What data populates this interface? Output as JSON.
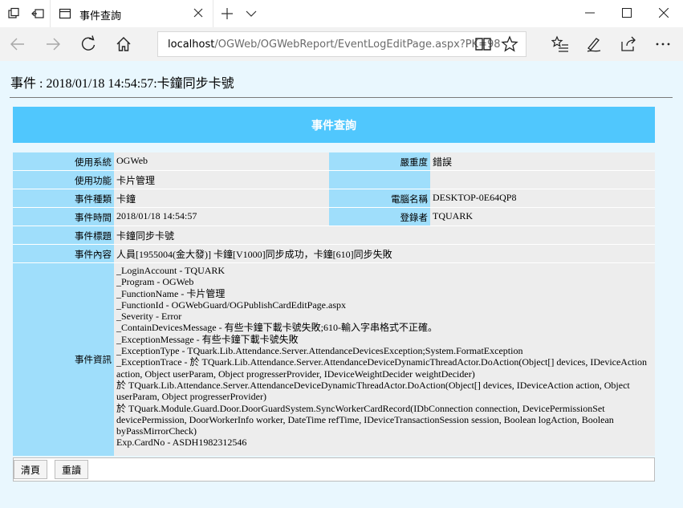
{
  "browser": {
    "tab_title": "事件查詢",
    "address_host": "localhost",
    "address_path": "/OGWeb/OGWebReport/EventLogEditPage.aspx?PK=98"
  },
  "page": {
    "title": "事件 : 2018/01/18 14:54:57:卡鐘同步卡號",
    "panel_title": "事件查詢"
  },
  "fields": {
    "system_label": "使用系統",
    "system_value": "OGWeb",
    "severity_label": "嚴重度",
    "severity_value": "錯誤",
    "function_label": "使用功能",
    "function_value": "卡片管理",
    "type_label": "事件種類",
    "type_value": "卡鐘",
    "computer_label": "電腦名稱",
    "computer_value": "DESKTOP-0E64QP8",
    "time_label": "事件時間",
    "time_value": "2018/01/18 14:54:57",
    "login_label": "登錄者",
    "login_value": "TQUARK",
    "subject_label": "事件標題",
    "subject_value": "卡鐘同步卡號",
    "content_label": "事件內容",
    "content_value": "人員[1955004(金大發)] 卡鐘[V1000]同步成功，卡鐘[610]同步失敗",
    "detail_label": "事件資訊"
  },
  "detail_lines": [
    "_LoginAccount - TQUARK",
    "_Program - OGWeb",
    "_FunctionName - 卡片管理",
    "_FunctionId - OGWebGuard/OGPublishCardEditPage.aspx",
    "_Severity - Error",
    "_ContainDevicesMessage - 有些卡鐘下載卡號失敗;610-輸入字串格式不正確。",
    "_ExceptionMessage - 有些卡鐘下載卡號失敗",
    "_ExceptionType - TQuark.Lib.Attendance.Server.AttendanceDevicesException;System.FormatException",
    "_ExceptionTrace - 於 TQuark.Lib.Attendance.Server.AttendanceDeviceDynamicThreadActor.DoAction(Object[] devices, IDeviceAction action, Object userParam, Object progresserProvider, IDeviceWeightDecider weightDecider)",
    "於 TQuark.Lib.Attendance.Server.AttendanceDeviceDynamicThreadActor.DoAction(Object[] devices, IDeviceAction action, Object userParam, Object progresserProvider)",
    "於 TQuark.Module.Guard.Door.DoorGuardSystem.SyncWorkerCardRecord(IDbConnection connection, DevicePermissionSet devicePermission, DoorWorkerInfo worker, DateTime refTime, IDeviceTransactionSession session, Boolean logAction, Boolean byPassMirrorCheck)",
    "Exp.CardNo - ASDH1982312546"
  ],
  "buttons": {
    "clear_label": "清頁",
    "reload_label": "重讀"
  }
}
